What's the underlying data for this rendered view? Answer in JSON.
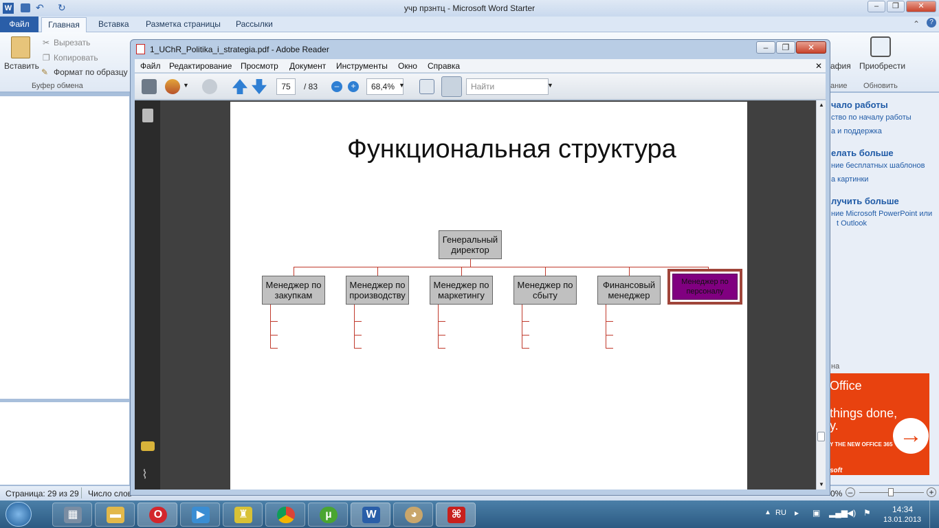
{
  "word": {
    "title": "учр прзнтц  -  Microsoft Word Starter",
    "tabs": [
      "Файл",
      "Главная",
      "Вставка",
      "Разметка страницы",
      "Рассылки"
    ],
    "ribbon": {
      "paste": "Вставить",
      "cut": "Вырезать",
      "copy": "Копировать",
      "format_painter": "Формат по образцу",
      "clipboard_group": "Буфер обмена",
      "photo_partial": "афия",
      "buy": "Приобрести",
      "edit_partial": "ание",
      "update_group": "Обновить"
    },
    "right_pane": {
      "h1": "чало работы",
      "l1": "ство по началу работы",
      "l2": "а и поддержка",
      "h2": "елать больше",
      "l3": "ние бесплатных шаблонов",
      "l4": "а картинки",
      "h3": "лучить больше",
      "l5": "ние Microsoft PowerPoint или",
      "l6": "t Outlook",
      "l7": "на"
    },
    "ad": {
      "line1": "Office",
      "line2": "things done,",
      "line3": "y.",
      "cta": "Y THE NEW OFFICE 365",
      "logo": "soft"
    },
    "status": {
      "page": "Страница: 29 из 29",
      "words": "Число слов",
      "zoom": "0%"
    }
  },
  "reader": {
    "title": "1_UChR_Politika_i_strategia.pdf - Adobe Reader",
    "menu": [
      "Файл",
      "Редактирование",
      "Просмотр",
      "Документ",
      "Инструменты",
      "Окно",
      "Справка"
    ],
    "page_current": "75",
    "page_total": "/ 83",
    "zoom": "68,4%",
    "find_placeholder": "Найти"
  },
  "slide": {
    "title": "Функциональная структура",
    "ceo": "Генеральный директор",
    "managers": [
      "Менеджер по закупкам",
      "Менеджер по производству",
      "Менеджер по маркетингу",
      "Менеджер по сбыту",
      "Финансовый менеджер",
      "Менеджер по персоналу"
    ]
  },
  "taskbar": {
    "lang": "RU",
    "time": "14:34",
    "date": "13.01.2013"
  },
  "colors": {
    "line": "#c0392b",
    "highlight_box": "#800080",
    "highlight_border": "#a0453a",
    "ad": "#e8420f"
  }
}
